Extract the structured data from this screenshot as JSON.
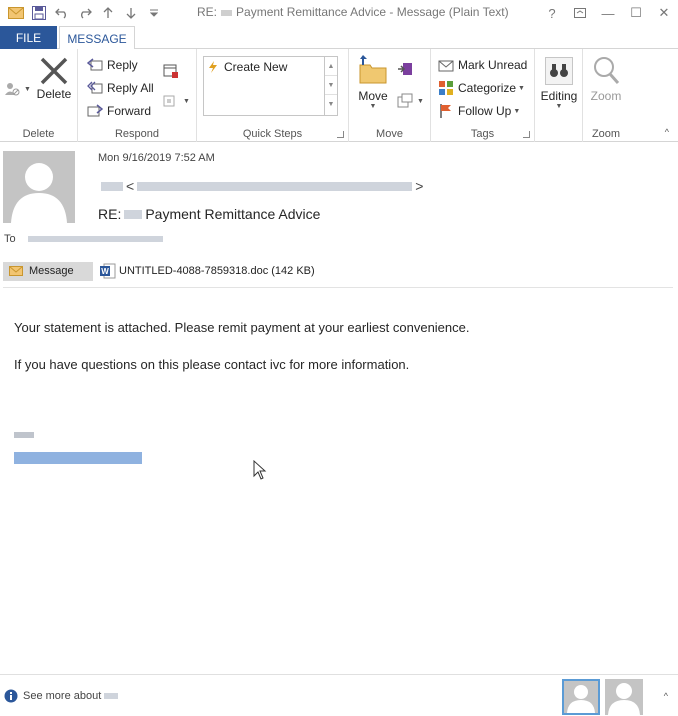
{
  "window": {
    "title_prefix": "RE:",
    "title_main": "Payment Remittance Advice - Message (Plain Text)",
    "help": "?",
    "minimize": "—",
    "maximize": "☐",
    "close": "✕"
  },
  "tabs": {
    "file": "FILE",
    "message": "MESSAGE"
  },
  "ribbon": {
    "delete_group": {
      "delete_label": "Delete",
      "group_label": "Delete"
    },
    "respond_group": {
      "reply": "Reply",
      "reply_all": "Reply All",
      "forward": "Forward",
      "group_label": "Respond"
    },
    "quick_steps": {
      "create_new": "Create New",
      "group_label": "Quick Steps"
    },
    "move_group": {
      "move": "Move",
      "group_label": "Move"
    },
    "tags_group": {
      "mark_unread": "Mark Unread",
      "categorize": "Categorize",
      "follow_up": "Follow Up",
      "group_label": "Tags"
    },
    "editing": {
      "label": "Editing"
    },
    "zoom_group": {
      "zoom": "Zoom",
      "group_label": "Zoom"
    }
  },
  "message": {
    "date": "Mon 9/16/2019 7:52 AM",
    "from_bracket_open": "<",
    "from_bracket_close": ">",
    "subject_prefix": "RE:",
    "subject": "Payment Remittance Advice",
    "to_label": "To",
    "message_chip": "Message",
    "attachment": "UNTITLED-4088-7859318.doc (142 KB)",
    "body_line1": "Your statement is attached. Please remit payment at your earliest convenience.",
    "body_line2": "If you have questions on this please contact ivc for more information."
  },
  "footer": {
    "see_more": "See more about"
  },
  "colors": {
    "accent": "#2b579a",
    "file_tab": "#2b579a"
  }
}
